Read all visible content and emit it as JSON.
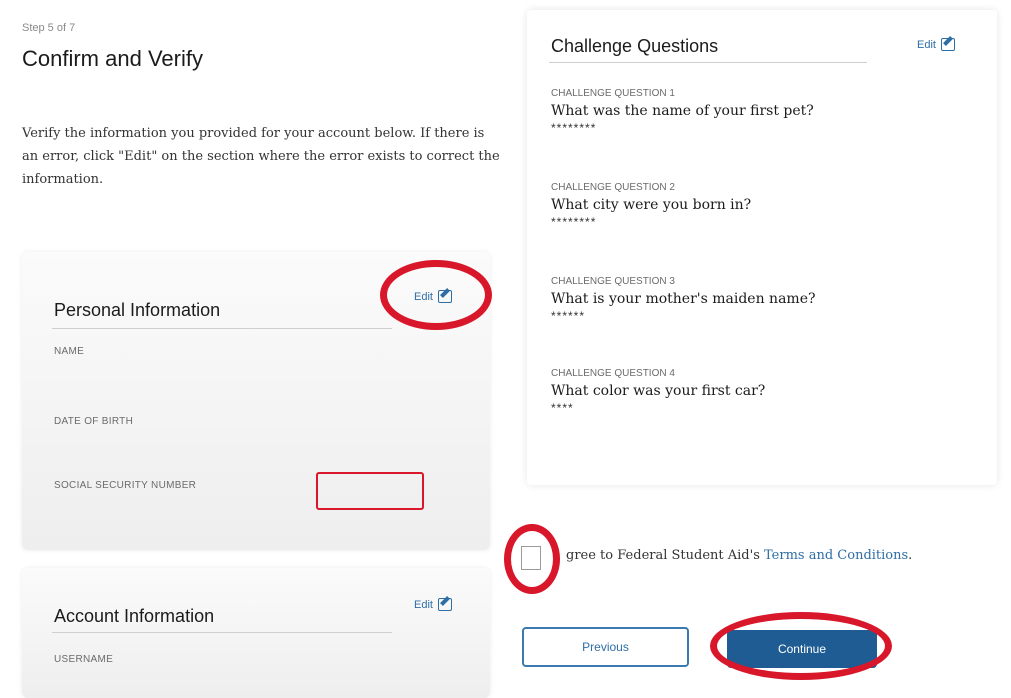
{
  "header": {
    "step": "Step 5 of 7",
    "title": "Confirm and Verify",
    "intro": "Verify the information you provided for your account below. If there is an error, click \"Edit\" on the section where the error exists to correct the information."
  },
  "personal": {
    "title": "Personal Information",
    "edit_label": "Edit",
    "fields": {
      "name_label": "NAME",
      "dob_label": "DATE OF BIRTH",
      "ssn_label": "SOCIAL SECURITY NUMBER"
    }
  },
  "account": {
    "title": "Account Information",
    "edit_label": "Edit",
    "username_label": "USERNAME"
  },
  "challenge": {
    "title": "Challenge Questions",
    "edit_label": "Edit",
    "questions": [
      {
        "label": "CHALLENGE QUESTION 1",
        "question": "What was the name of your first pet?",
        "answer": "********"
      },
      {
        "label": "CHALLENGE QUESTION 2",
        "question": "What city were you born in?",
        "answer": "********"
      },
      {
        "label": "CHALLENGE QUESTION 3",
        "question": "What is your mother's maiden name?",
        "answer": "******"
      },
      {
        "label": "CHALLENGE QUESTION 4",
        "question": "What color was your first car?",
        "answer": "****"
      }
    ]
  },
  "terms": {
    "prefix": "gree to Federal Student Aid's ",
    "link": "Terms and Conditions",
    "suffix": "."
  },
  "buttons": {
    "previous": "Previous",
    "continue": "Continue"
  },
  "colors": {
    "accent": "#2e6ea5",
    "primary_button": "#1f5c93",
    "highlight_annotation": "#d8172b"
  }
}
